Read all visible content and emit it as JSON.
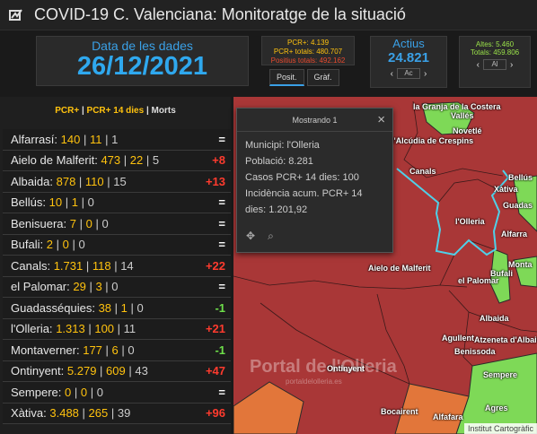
{
  "header": {
    "title": "COVID-19 C. Valenciana: Monitoratge de la situació"
  },
  "date_panel": {
    "label": "Data de les dades",
    "value": "26/12/2021"
  },
  "pcr_panel": {
    "pcr": "PCR+: 4.139",
    "pcr_total": "PCR+ totals: 480.707",
    "positius_total": "Positius totals: 492.162"
  },
  "tabs": [
    "Posit.",
    "Gràf."
  ],
  "actius": {
    "label": "Actius",
    "value": "24.821",
    "page": "Ac"
  },
  "altes": {
    "altes": "Altes: 5.460",
    "totals": "Totals: 459.806",
    "page": "Al"
  },
  "list": {
    "header_pcr": "PCR+",
    "header_sep": " | ",
    "header_pcr14": "PCR+ 14 dies",
    "header_morts": "Morts",
    "rows": [
      {
        "mun": "Alfarrasí:",
        "n1": "140",
        "n2": "11",
        "n3": "1",
        "delta": "=",
        "dc": "white"
      },
      {
        "mun": "Aielo de Malferit:",
        "n1": "473",
        "n2": "22",
        "n3": "5",
        "delta": "+8",
        "dc": "red"
      },
      {
        "mun": "Albaida:",
        "n1": "878",
        "n2": "110",
        "n3": "15",
        "delta": "+13",
        "dc": "red"
      },
      {
        "mun": "Bellús:",
        "n1": "10",
        "n2": "1",
        "n3": "0",
        "delta": "=",
        "dc": "white"
      },
      {
        "mun": "Benisuera:",
        "n1": "7",
        "n2": "0",
        "n3": "0",
        "delta": "=",
        "dc": "white"
      },
      {
        "mun": "Bufali:",
        "n1": "2",
        "n2": "0",
        "n3": "0",
        "delta": "=",
        "dc": "white"
      },
      {
        "mun": "Canals:",
        "n1": "1.731",
        "n2": "118",
        "n3": "14",
        "delta": "+22",
        "dc": "red"
      },
      {
        "mun": "el Palomar:",
        "n1": "29",
        "n2": "3",
        "n3": "0",
        "delta": "=",
        "dc": "white"
      },
      {
        "mun": "Guadasséquies:",
        "n1": "38",
        "n2": "1",
        "n3": "0",
        "delta": "-1",
        "dc": "green"
      },
      {
        "mun": "l'Olleria:",
        "n1": "1.313",
        "n2": "100",
        "n3": "11",
        "delta": "+21",
        "dc": "red"
      },
      {
        "mun": "Montaverner:",
        "n1": "177",
        "n2": "6",
        "n3": "0",
        "delta": "-1",
        "dc": "green"
      },
      {
        "mun": "Ontinyent:",
        "n1": "5.279",
        "n2": "609",
        "n3": "43",
        "delta": "+47",
        "dc": "red"
      },
      {
        "mun": "Sempere:",
        "n1": "0",
        "n2": "0",
        "n3": "0",
        "delta": "=",
        "dc": "white"
      },
      {
        "mun": "Xàtiva:",
        "n1": "3.488",
        "n2": "265",
        "n3": "39",
        "delta": "+96",
        "dc": "red"
      }
    ]
  },
  "popup": {
    "title": "Mostrando 1",
    "lines": [
      "Municipi: l'Olleria",
      "Població: 8.281",
      "Casos PCR+ 14 dies: 100",
      "Incidència acum. PCR+ 14",
      "dies: 1.201,92"
    ]
  },
  "map": {
    "labels": [
      "la Granja de la Costera",
      "Vallés",
      "Novetlé",
      "l'Alcúdia de Crespins",
      "Canals",
      "Xàtiva",
      "Bellús",
      "Guadas",
      "l'Olleria",
      "Alfarra",
      "Aielo de Malferit",
      "Bufali",
      "Monta",
      "el Palomar",
      "Albaida",
      "Agullent",
      "Atzeneta d'Albaida",
      "Benissoda",
      "Ontinyent",
      "Sempere",
      "Bocairent",
      "Alfafara",
      "Agres"
    ],
    "watermark": "Portal de l'Olleria",
    "watermark_sub": "portaldelolleria.es",
    "attribution": "Institut Cartogràfic",
    "colors": {
      "map_red": "#a93737",
      "green": "#7ed957",
      "orange": "#e2763a",
      "boundary": "#4fd0e8"
    }
  }
}
